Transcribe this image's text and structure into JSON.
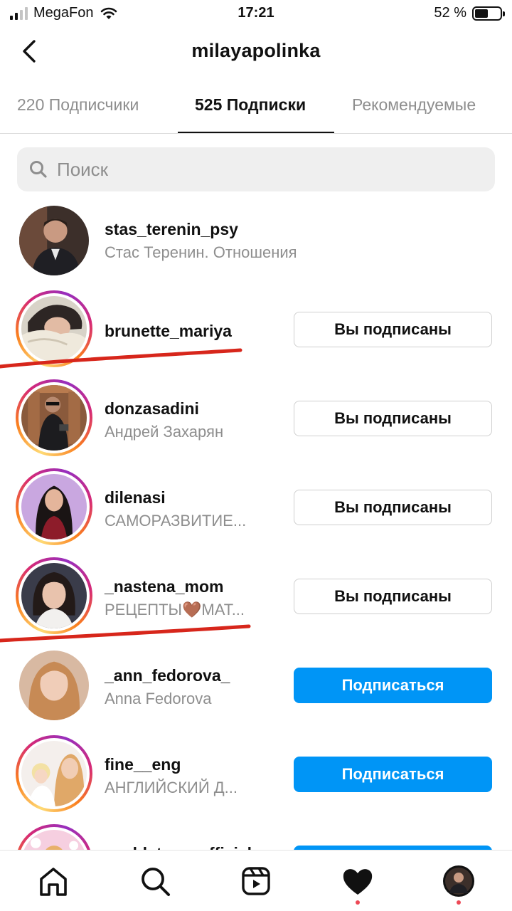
{
  "status_bar": {
    "carrier": "MegaFon",
    "time": "17:21",
    "battery": "52 %",
    "battery_level": 0.52
  },
  "header": {
    "title": "milayapolinka",
    "back_icon": "chevron-left-icon"
  },
  "tabs": [
    {
      "label": "220 Подписчики",
      "active": false
    },
    {
      "label": "525 Подписки",
      "active": true
    },
    {
      "label": "Рекомендуемые",
      "active": false
    }
  ],
  "search": {
    "placeholder": "Поиск",
    "value": ""
  },
  "users": [
    {
      "username": "stas_terenin_psy",
      "full_name": "Стас Теренин. Отношения",
      "button": "",
      "story_ring": false
    },
    {
      "username": "brunette_mariya",
      "full_name": "",
      "button": "Вы подписаны",
      "story_ring": true
    },
    {
      "username": "donzasadini",
      "full_name": "Андрей Захарян",
      "button": "Вы подписаны",
      "story_ring": true
    },
    {
      "username": "dilenasi",
      "full_name": "САМОРАЗВИТИЕ...",
      "button": "Вы подписаны",
      "story_ring": true
    },
    {
      "username": "_nastena_mom",
      "full_name": "РЕЦЕПТЫ🤎МАТ...",
      "button": "Вы подписаны",
      "story_ring": true
    },
    {
      "username": "_ann_fedorova_",
      "full_name": "Anna Fedorova",
      "button": "Подписаться",
      "story_ring": false
    },
    {
      "username": "fine__eng",
      "full_name": "АНГЛИЙСКИЙ Д...",
      "button": "Подписаться",
      "story_ring": true
    },
    {
      "username": "ssoldatova_official",
      "full_name": "",
      "button": "",
      "story_ring": true
    }
  ],
  "bottom_nav": [
    {
      "icon": "home-icon"
    },
    {
      "icon": "search-icon"
    },
    {
      "icon": "reels-icon"
    },
    {
      "icon": "heart-icon",
      "badge": true
    },
    {
      "icon": "profile-avatar",
      "badge": true
    }
  ],
  "colors": {
    "accent": "#0095f6",
    "marker": "#d7261b",
    "badge": "#ed4956"
  }
}
